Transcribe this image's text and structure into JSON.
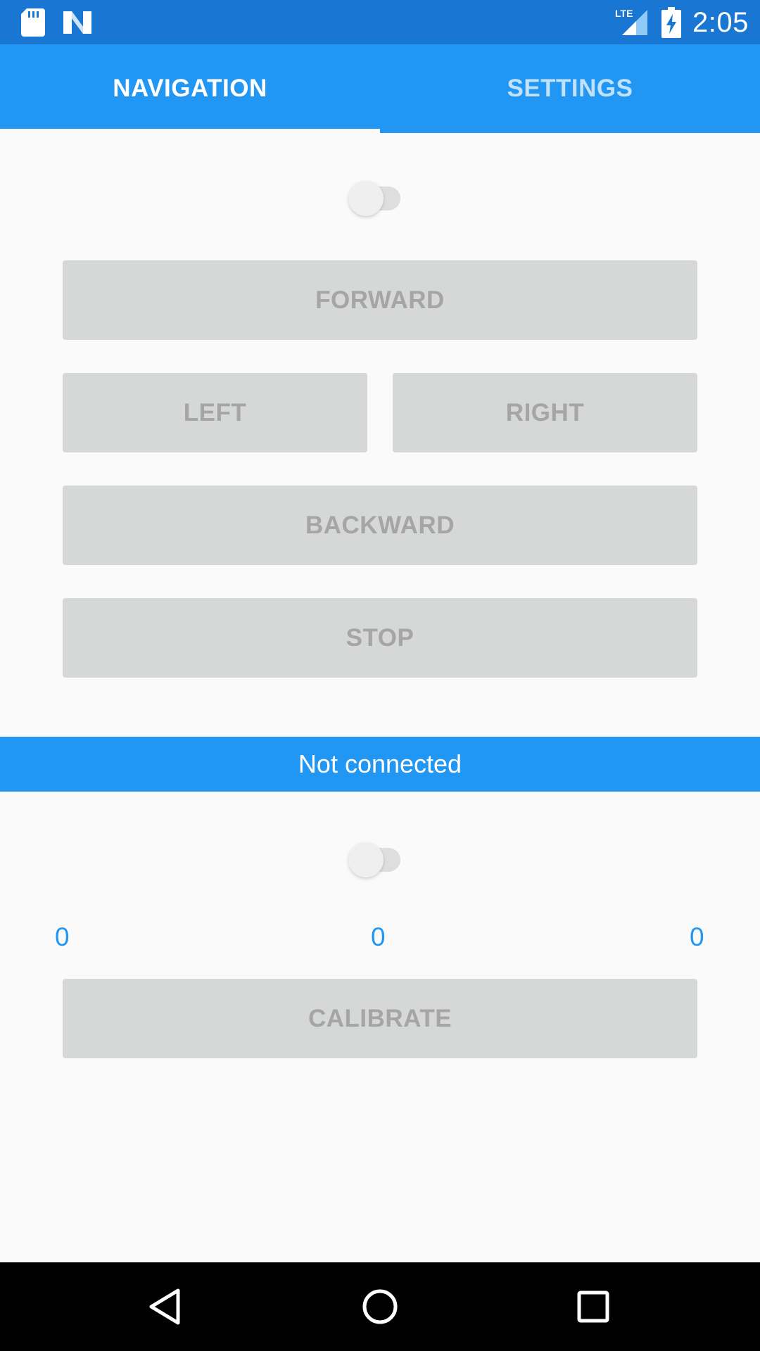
{
  "status_bar": {
    "time": "2:05",
    "icons": [
      "sd-card-icon",
      "n-notification-icon",
      "lte-signal-icon",
      "battery-charging-icon"
    ],
    "color": "#1976d2",
    "lte_label": "LTE"
  },
  "tabs": [
    {
      "label": "NAVIGATION",
      "selected": true
    },
    {
      "label": "SETTINGS",
      "selected": false
    }
  ],
  "colors": {
    "primary": "#2196f3",
    "primary_dark": "#1976d2",
    "button_bg": "#d6d7d7",
    "button_text_disabled": "#a5a5a5",
    "background": "#fafafa"
  },
  "navigation": {
    "enable_switch_on": false,
    "buttons": {
      "forward": "FORWARD",
      "left": "LEFT",
      "right": "RIGHT",
      "backward": "BACKWARD",
      "stop": "STOP"
    }
  },
  "connection": {
    "status": "Not connected"
  },
  "calibration": {
    "switch_on": false,
    "readouts": [
      "0",
      "0",
      "0"
    ],
    "calibrate_label": "CALIBRATE"
  },
  "system_nav": {
    "icons": [
      "back-icon",
      "home-icon",
      "recents-icon"
    ]
  }
}
